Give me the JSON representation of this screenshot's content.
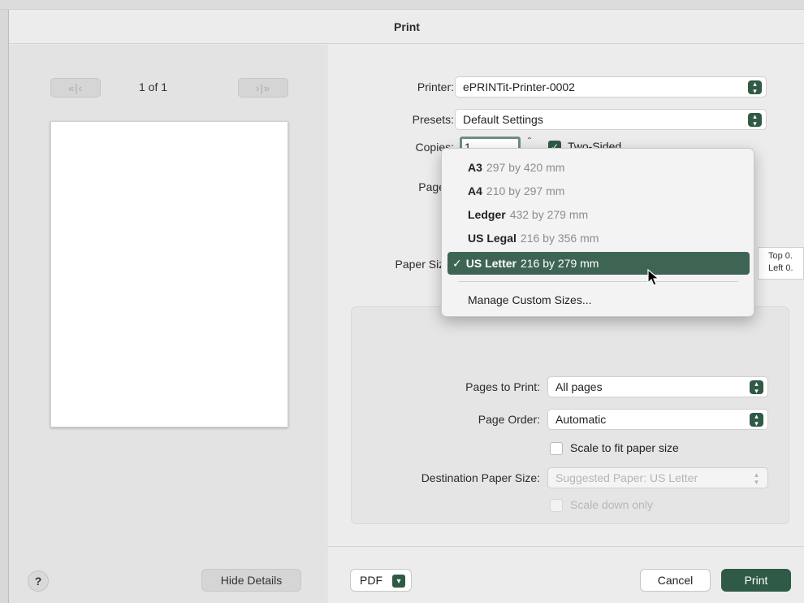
{
  "window": {
    "title": "Print"
  },
  "preview": {
    "first_label": "«|‹",
    "last_label": "›|»",
    "page_count": "1 of 1"
  },
  "fields": {
    "printer": {
      "label": "Printer:",
      "value": "ePRINTit-Printer-0002"
    },
    "presets": {
      "label": "Presets:",
      "value": "Default Settings"
    },
    "copies": {
      "label": "Copies:",
      "value": "1"
    },
    "two_sided": {
      "label": "Two-Sided",
      "checked": true
    },
    "pages": {
      "label": "Pages"
    },
    "paper_size": {
      "label": "Paper Size"
    },
    "pages_to_print": {
      "label": "Pages to Print:",
      "value": "All pages"
    },
    "page_order": {
      "label": "Page Order:",
      "value": "Automatic"
    },
    "scale_to_fit": {
      "label": "Scale to fit paper size",
      "checked": false
    },
    "destination_paper_size": {
      "label": "Destination Paper Size:",
      "value": "Suggested Paper: US Letter"
    },
    "scale_down_only": {
      "label": "Scale down only",
      "checked": false,
      "disabled": true
    }
  },
  "paper_menu": {
    "items": [
      {
        "name": "A3",
        "dims": "297 by 420 mm",
        "selected": false
      },
      {
        "name": "A4",
        "dims": "210 by 297 mm",
        "selected": false
      },
      {
        "name": "Ledger",
        "dims": "432 by 279 mm",
        "selected": false
      },
      {
        "name": "US Legal",
        "dims": "216 by 356 mm",
        "selected": false
      },
      {
        "name": "US Letter",
        "dims": "216 by 279 mm",
        "selected": true
      }
    ],
    "check_mark": "✓",
    "manage": "Manage Custom Sizes..."
  },
  "margins_tip": {
    "line1": "Top 0.",
    "line2": "Left 0."
  },
  "buttons": {
    "help": "?",
    "hide_details": "Hide Details",
    "pdf": "PDF",
    "cancel": "Cancel",
    "print": "Print"
  },
  "colors": {
    "accent": "#2f5a45",
    "selection": "#3e6553"
  }
}
